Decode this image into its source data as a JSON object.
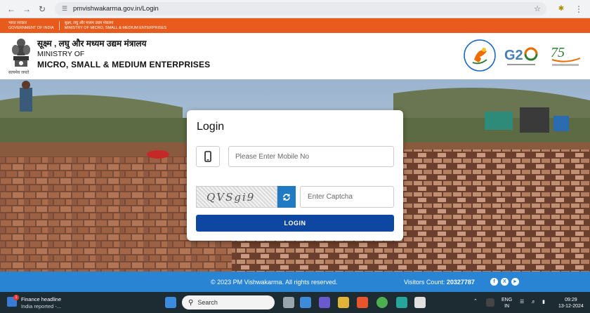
{
  "browser": {
    "url": "pmvishwakarma.gov.in/Login"
  },
  "gov_strip": {
    "items": [
      {
        "hindi": "भारत सरकार",
        "english": "GOVERNMENT OF INDIA"
      },
      {
        "hindi": "सूक्ष्म, लघु और मध्यम उद्यम मंत्रालय",
        "english": "MINISTRY OF MICRO, SMALL & MEDIUM ENTERPRISES"
      }
    ]
  },
  "header": {
    "ministry_hindi": "सूक्ष्म , लघु और मध्यम उद्यम मंत्रालय",
    "ministry_of": "MINISTRY OF",
    "ministry_name": "MICRO, SMALL & MEDIUM ENTERPRISES",
    "emblem_caption": "सत्यमेव जयते"
  },
  "login": {
    "title": "Login",
    "mobile_placeholder": "Please Enter Mobile No",
    "captcha_text": "QVSgi9",
    "captcha_placeholder": "Enter Captcha",
    "button_label": "LOGIN"
  },
  "footer": {
    "copyright": "© 2023 PM Vishwakarma. All rights reserved.",
    "visitors_label": "Visitors Count:",
    "visitors_count": "20327787",
    "social": [
      "f",
      "X",
      "►"
    ]
  },
  "taskbar": {
    "news_title": "Finance headline",
    "news_subtitle": "India reported -...",
    "search_label": "Search",
    "lang_line1": "ENG",
    "lang_line2": "IN",
    "time": "09:29",
    "date": "13-12-2024"
  },
  "colors": {
    "gov_strip": "#e75b1c",
    "login_button": "#0d47a1",
    "footer": "#2a84d4",
    "taskbar": "#1d2b33"
  }
}
